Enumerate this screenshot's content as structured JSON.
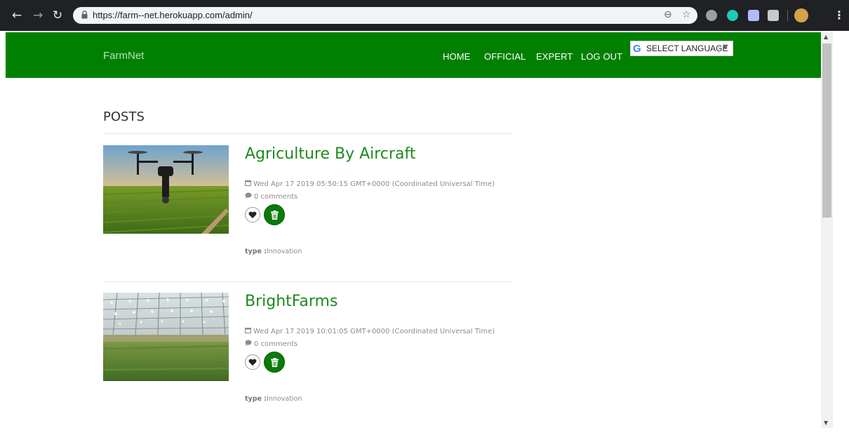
{
  "browser": {
    "url": "https://farm--net.herokuapp.com/admin/"
  },
  "navbar": {
    "brand": "FarmNet",
    "links": [
      {
        "label": "HOME"
      },
      {
        "label": "OFFICIAL"
      },
      {
        "label": "EXPERT"
      },
      {
        "label": "LOG OUT"
      }
    ],
    "translate": {
      "label": "SELECT LANGUAGE",
      "logo": "G",
      "arrow": "▼"
    }
  },
  "content": {
    "heading": "POSTS",
    "posts": [
      {
        "title": "Agriculture By Aircraft",
        "date": "Wed Apr 17 2019 05:50:15 GMT+0000 (Coordinated Universal Time)",
        "comments": "0 comments",
        "type_label": "type :",
        "type_value": "Innovation"
      },
      {
        "title": "BrightFarms",
        "date": "Wed Apr 17 2019 10:01:05 GMT+0000 (Coordinated Universal Time)",
        "comments": "0 comments",
        "type_label": "type :",
        "type_value": "Innovation"
      }
    ]
  },
  "colors": {
    "navbar_bg": "#008000",
    "title_green": "#1e8a1e",
    "delete_button": "#0a7a0a"
  },
  "icons": {
    "back": "arrow-left-icon",
    "forward": "arrow-right-icon",
    "reload": "reload-icon",
    "lock": "lock-icon",
    "zoom": "zoom-icon",
    "star": "star-icon",
    "calendar": "calendar-icon",
    "comment": "comment-icon",
    "like": "heart-icon",
    "delete": "trash-icon"
  }
}
